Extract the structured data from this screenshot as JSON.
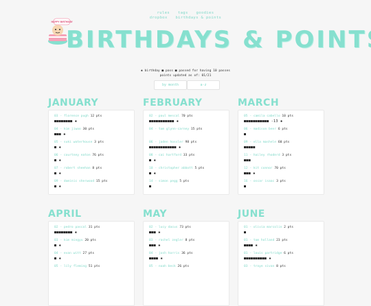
{
  "nav": {
    "row1": [
      "rules",
      "tags",
      "goodies"
    ],
    "row2": [
      "dropbox",
      "birthdays & points"
    ]
  },
  "title": "BIRTHDAYS & POINTS",
  "logo_text": "HAPPY BIRTHDAY",
  "legend": {
    "line": "✱ birthday   ■ pass   ■ passed for having 10 passes",
    "updated": "points updated as of: 01/21"
  },
  "sort": [
    "by month",
    "a-z"
  ],
  "months": [
    {
      "name": "JANUARY",
      "entries": [
        {
          "day": "03",
          "name": "florence pugh",
          "pts": "12 pts",
          "marks": "■■■■■■■■ ✱"
        },
        {
          "day": "04",
          "name": "kim jiwoo",
          "pts": "30 pts",
          "marks": "■■■ ✱"
        },
        {
          "day": "05",
          "name": "suki waterhouse",
          "pts": "3 pts",
          "marks": "■ ✱"
        },
        {
          "day": "06",
          "name": "courtney eaton",
          "pts": "76 pts",
          "marks": "■ ✱"
        },
        {
          "day": "07",
          "name": "robert sheehan",
          "pts": "8 pts",
          "marks": "■ ✱"
        },
        {
          "day": "09",
          "name": "dominic sherwood",
          "pts": "15 pts",
          "marks": "■ ✱"
        }
      ]
    },
    {
      "name": "FEBRUARY",
      "entries": [
        {
          "day": "02",
          "name": "paul mescal",
          "pts": "70 pts",
          "marks": "■■■■■■■■■■■ ✱"
        },
        {
          "day": "04",
          "name": "tom glynn-carney",
          "pts": "15 pts",
          "marks": ""
        },
        {
          "day": "06",
          "name": "jaden hossler",
          "pts": "98 pts",
          "marks": "■■■■■■■■■■■■ ✱"
        },
        {
          "day": "08",
          "name": "cai hartford",
          "pts": "33 pts",
          "marks": "■ ✱"
        },
        {
          "day": "10",
          "name": "christopher abbott",
          "pts": "5 pts",
          "marks": "■ ✱"
        },
        {
          "day": "14",
          "name": "simon pegg",
          "pts": "5 pts",
          "marks": "■"
        }
      ]
    },
    {
      "name": "MARCH",
      "entries": [
        {
          "day": "05",
          "name": "camila cabello",
          "pts": "10 pts",
          "marks": "■■■■■■■■■■■ -13 ✱"
        },
        {
          "day": "06",
          "name": "madison beer",
          "pts": "6 pts",
          "marks": "■"
        },
        {
          "day": "09",
          "name": "ella mashele",
          "pts": "60 pts",
          "marks": "■■■■■"
        },
        {
          "day": "11",
          "name": "hailey rhoderd",
          "pts": "3 pts",
          "marks": "■■■"
        },
        {
          "day": "12",
          "name": "kit connor",
          "pts": "70 pts",
          "marks": "■■■ ✱"
        },
        {
          "day": "16",
          "name": "oscar isaac",
          "pts": "3 pts",
          "marks": "■"
        }
      ]
    },
    {
      "name": "APRIL",
      "entries": [
        {
          "day": "02",
          "name": "pedro pascal",
          "pts": "31 pts",
          "marks": "■■■■■■■■ ✱"
        },
        {
          "day": "03",
          "name": "kim mingyu",
          "pts": "20 pts",
          "marks": "■ ✱"
        },
        {
          "day": "04",
          "name": "evan witt",
          "pts": "27 pts",
          "marks": "■ ✱"
        },
        {
          "day": "05",
          "name": "lily fleming",
          "pts": "51 pts",
          "marks": ""
        }
      ]
    },
    {
      "name": "MAY",
      "entries": [
        {
          "day": "02",
          "name": "lucy dacus",
          "pts": "73 pts",
          "marks": "■■■ ✱"
        },
        {
          "day": "03",
          "name": "rachel zegler",
          "pts": "8 pts",
          "marks": "■■■ ✱"
        },
        {
          "day": "04",
          "name": "josh harris",
          "pts": "36 pts",
          "marks": "■■■■ ✱"
        },
        {
          "day": "05",
          "name": "noah beck",
          "pts": "26 pts",
          "marks": ""
        }
      ]
    },
    {
      "name": "JUNE",
      "entries": [
        {
          "day": "01",
          "name": "olivia marcolin",
          "pts": "2 pts",
          "marks": "■"
        },
        {
          "day": "01",
          "name": "tom holland",
          "pts": "23 pts",
          "marks": "■■■■ ✱"
        },
        {
          "day": "01",
          "name": "louis partridge",
          "pts": "6 pts",
          "marks": "■■■■■■■■■■ ✱"
        },
        {
          "day": "03",
          "name": "troye sivan",
          "pts": "8 pts",
          "marks": ""
        }
      ]
    }
  ]
}
